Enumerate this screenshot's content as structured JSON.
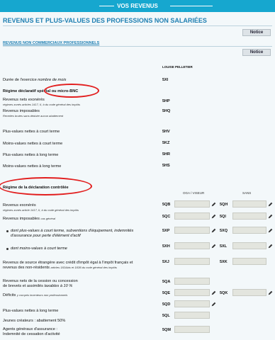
{
  "header": {
    "title": "VOS REVENUS"
  },
  "page": {
    "heading": "REVENUS ET PLUS-VALUES DES PROFESSIONS NON SALARIÉES"
  },
  "notice_label": "Notice",
  "section_bnc": {
    "heading": "REVENUS NON COMMERCIAUX PROFESSIONNELS",
    "person": "LOUISE PELLETIER",
    "duree": {
      "label": "Durée de l'exercice ",
      "label_it": "nombre de mois",
      "code": "5XI"
    },
    "regime_title": "Régime déclaratif spécial ou micro-BNC",
    "rows": [
      {
        "label": "Revenus nets exonérés",
        "sub": "régimes zonés articles 1417, II, b du code général des impôts",
        "code": "5HP"
      },
      {
        "label": "Revenus imposables",
        "sub": "Recettes brutes sans déduire aucun abattement",
        "code": "5HQ"
      },
      {
        "label": "Plus-values nettes à court terme",
        "code": "5HV"
      },
      {
        "label": "Moins-values nettes à court terme",
        "code": "5KZ"
      },
      {
        "label": "Plus-values nettes à long terme",
        "code": "5HR"
      },
      {
        "label": "Moins-values nettes à long terme",
        "code": "5HS"
      }
    ]
  },
  "section_controlee": {
    "title": "Régime de la déclaration contrôlée",
    "col_oga": "OGA / VISEUR",
    "col_sans": "SANS",
    "exoneres": {
      "label": "Revenus exonérés",
      "sub": "régimes zonés article 1417, II, b du code général des impôts",
      "code1": "5QB",
      "code2": "5QH"
    },
    "imposables": {
      "label": "Revenus imposables",
      "label_it": "cas général",
      "code1": "5QC",
      "code2": "5QI"
    },
    "dont_pv": {
      "label": "dont plus-values à court terme, subventions d'équipement, indemnités d'assurance pour perte d'élément d'actif",
      "line1": "dont plus-values à court terme, subventions d'équipement, indemnités",
      "line2": "d'assurance pour perte d'élément d'actif",
      "code1": "5XP",
      "code2": "5XQ"
    },
    "dont_mv": {
      "label": "dont moins-values à court terme",
      "code1": "5XH",
      "code2": "5XL"
    },
    "etrangere": {
      "line1": "Revenus de source étrangère avec crédit d'impôt égal à l'impôt français et",
      "line2": "revenus des non-résidents ",
      "line2_small": "articles 182Abis et 182B du code général des impôts",
      "code1": "5XJ",
      "code2": "5XK"
    },
    "cession": {
      "line1": "Revenus nets de la cession ou concession",
      "line2": "de brevets et assimilés ",
      "line2_it": "taxables à 10 %",
      "code1": "5QA",
      "code2": "5QE",
      "code3": "5QK"
    },
    "deficits": {
      "label": "Déficits ",
      "small": "y compris inventeurs non professionnels",
      "code": "5QD"
    },
    "pvlt": {
      "label": "Plus-values nettes à long terme",
      "code": "5QL"
    },
    "jeunes": {
      "label": "Jeunes créateurs : abattement 50%",
      "code": "5QL"
    },
    "agents": {
      "line1": "Agents généraux d'assurance :",
      "line2": "Indemnité de cessation d'activité",
      "code": "5QM"
    }
  },
  "colors": {
    "banner": "#16a7cf",
    "heading": "#1e7fb2",
    "annotation": "#e21e1e"
  }
}
